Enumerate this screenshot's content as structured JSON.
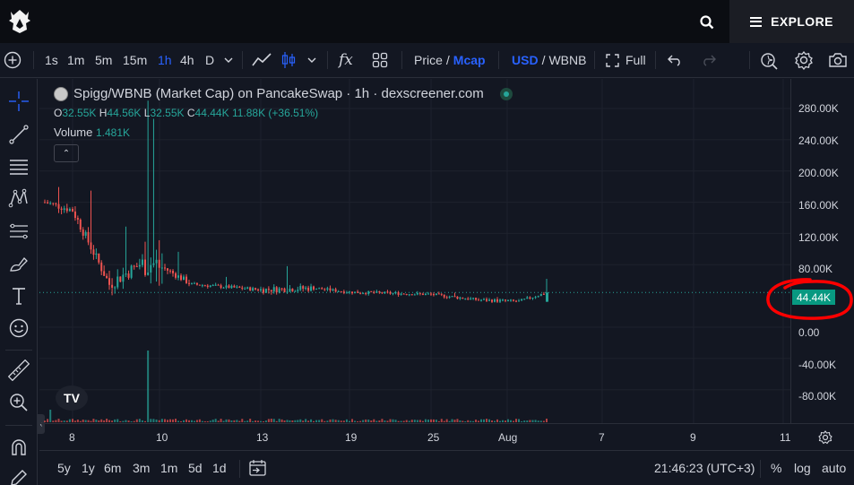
{
  "header": {
    "explore_label": "EXPLORE"
  },
  "toolbar": {
    "intervals": [
      "1s",
      "1m",
      "5m",
      "15m",
      "1h",
      "4h",
      "D"
    ],
    "active_interval": "1h",
    "price_label": "Price",
    "slash": "/",
    "mcap_label": "Mcap",
    "usd_label": "USD",
    "wbnb_label": "WBNB",
    "full_label": "Full",
    "fx_label": "fx"
  },
  "legend": {
    "title": "Spigg/WBNB (Market Cap) on PancakeSwap · 1h · dexscreener.com",
    "o_label": "O",
    "o_value": "32.55K",
    "h_label": "H",
    "h_value": "44.56K",
    "l_label": "L",
    "l_value": "32.55K",
    "c_label": "C",
    "c_value": "44.44K",
    "change": "11.88K (+36.51%)",
    "volume_label": "Volume",
    "volume_value": "1.481K",
    "collapse_glyph": "⌃"
  },
  "price_scale": {
    "ticks": [
      "280.00K",
      "240.00K",
      "200.00K",
      "160.00K",
      "120.00K",
      "80.00K",
      "0.00",
      "-40.00K",
      "-80.00K"
    ],
    "last_price": "44.44K"
  },
  "time_scale": {
    "ticks": [
      "8",
      "10",
      "13",
      "19",
      "25",
      "Aug",
      "7",
      "9",
      "11"
    ]
  },
  "bottom": {
    "ranges": [
      "5y",
      "1y",
      "6m",
      "3m",
      "1m",
      "5d",
      "1d"
    ],
    "clock": "21:46:23 (UTC+3)",
    "percent_label": "%",
    "log_label": "log",
    "auto_label": "auto"
  },
  "tv_logo": "TV",
  "colors": {
    "up": "#26a69a",
    "down": "#ef5350",
    "accent": "#2962ff",
    "annotation": "#ff0000",
    "background": "#131722"
  },
  "chart_data": {
    "type": "candlestick",
    "title": "Spigg/WBNB (Market Cap) on PancakeSwap · 1h · dexscreener.com",
    "x_ticks": [
      "8",
      "10",
      "13",
      "19",
      "25",
      "Aug",
      "7",
      "9",
      "11"
    ],
    "y_ticks": [
      "280.00K",
      "240.00K",
      "200.00K",
      "160.00K",
      "120.00K",
      "80.00K",
      "0.00",
      "-40.00K",
      "-80.00K"
    ],
    "ylim": [
      -100000,
      300000
    ],
    "last_value": 44440,
    "series": [
      {
        "name": "Market Cap",
        "points": [
          {
            "x": "Jul 7",
            "close": 160000,
            "high": 195000,
            "low": 140000
          },
          {
            "x": "Jul 8",
            "close": 150000,
            "high": 190000,
            "low": 120000
          },
          {
            "x": "Jul 9",
            "close": 55000,
            "high": 140000,
            "low": 40000
          },
          {
            "x": "Jul 10",
            "close": 85000,
            "high": 290000,
            "low": 50000
          },
          {
            "x": "Jul 11",
            "close": 75000,
            "high": 105000,
            "low": 60000
          },
          {
            "x": "Jul 12",
            "close": 55000,
            "high": 70000,
            "low": 45000
          },
          {
            "x": "Jul 13",
            "close": 48000,
            "high": 85000,
            "low": 40000
          },
          {
            "x": "Jul 16",
            "close": 50000,
            "high": 58000,
            "low": 42000
          },
          {
            "x": "Jul 19",
            "close": 45000,
            "high": 50000,
            "low": 40000
          },
          {
            "x": "Jul 25",
            "close": 42000,
            "high": 48000,
            "low": 36000
          },
          {
            "x": "Jul 28",
            "close": 35000,
            "high": 42000,
            "low": 28000
          },
          {
            "x": "Aug 1",
            "close": 33000,
            "high": 40000,
            "low": 30000
          },
          {
            "x": "Aug 4",
            "close": 44440,
            "high": 62000,
            "low": 32550
          }
        ]
      }
    ]
  }
}
